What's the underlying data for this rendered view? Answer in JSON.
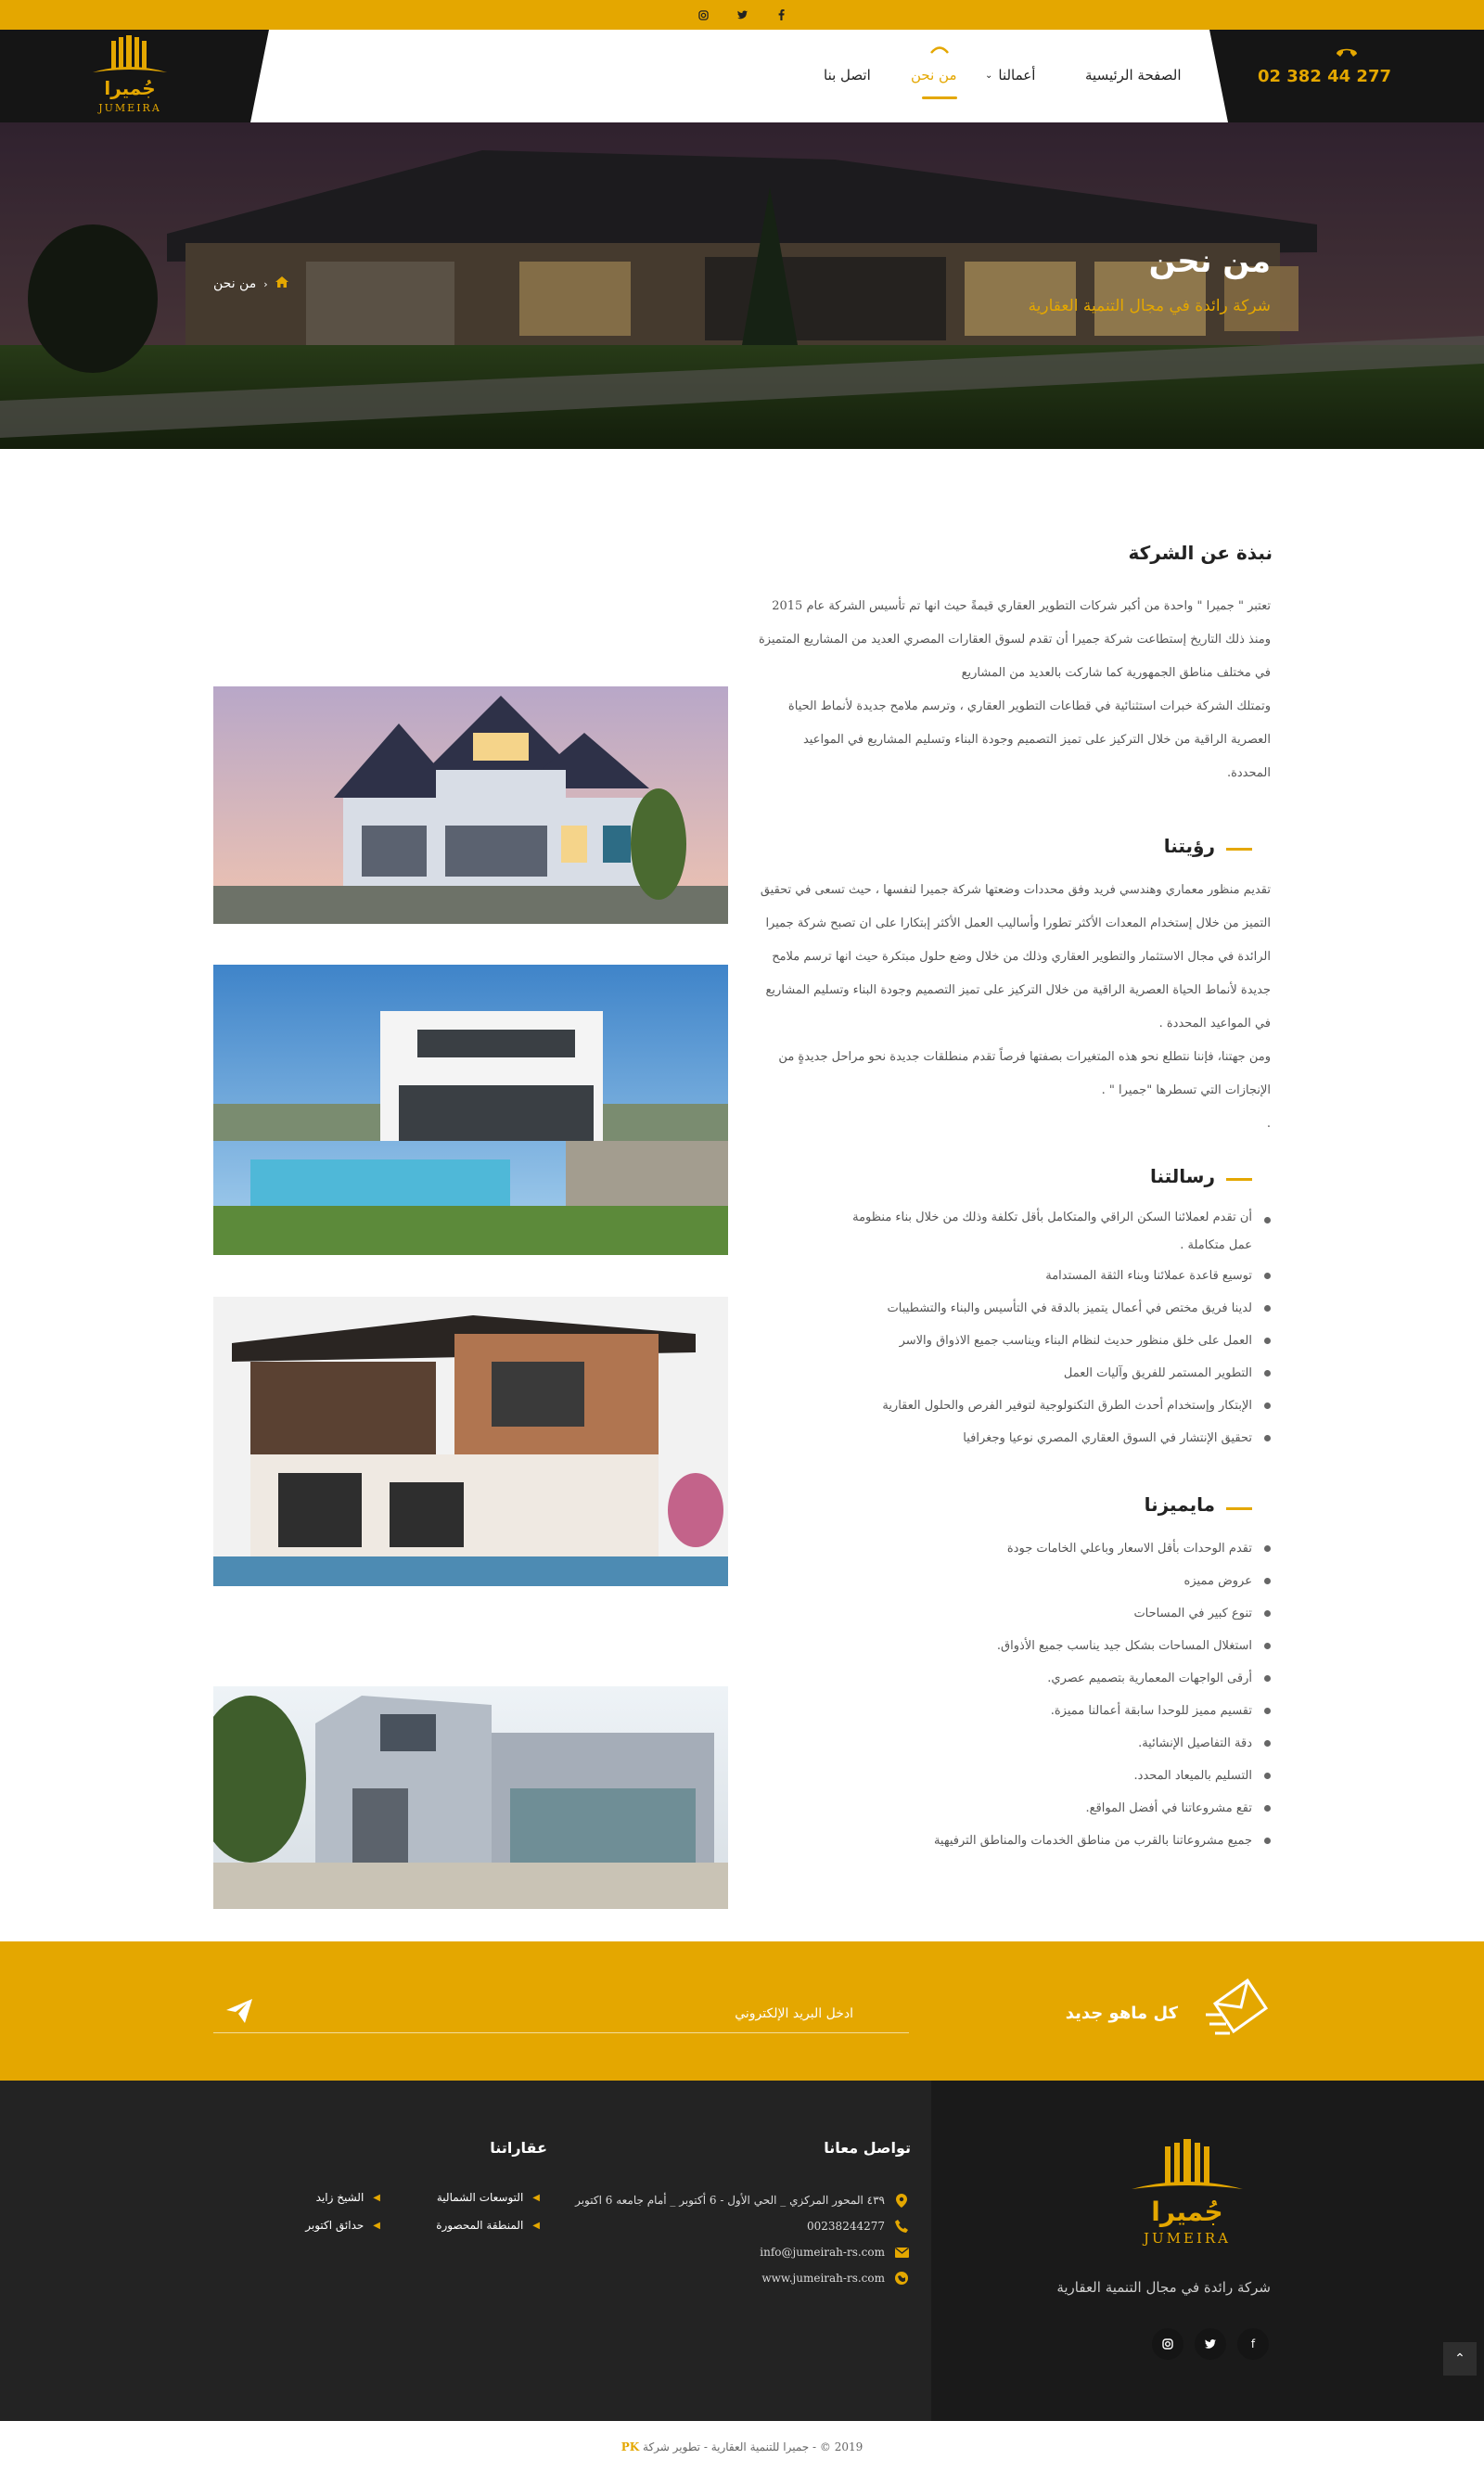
{
  "topbar": {
    "icons": [
      "instagram-icon",
      "twitter-icon",
      "facebook-icon"
    ]
  },
  "header": {
    "phone": "02 382 44 277",
    "logo_ar": "جُميرا",
    "logo_en": "JUMEIRA",
    "nav": [
      {
        "label": "الصفحة الرئيسية",
        "active": false
      },
      {
        "label": "أعمالنا",
        "active": false,
        "has_dropdown": true
      },
      {
        "label": "من نحن",
        "active": true
      },
      {
        "label": "اتصل بنا",
        "active": false
      }
    ]
  },
  "hero": {
    "title": "من نحن",
    "subtitle": "شركة رائدة في مجال التنمية العقارية",
    "breadcrumb": "من نحن"
  },
  "about": {
    "title": "نبذة عن الشركة",
    "lines": [
      "تعتبر \" جميرا \" واحدة من أكبر شركات التطوير العقاري قيمةً حيث انها تم تأسيس الشركة عام 2015",
      "ومنذ ذلك التاريخ إستطاعت شركة جميرا أن تقدم لسوق العقارات المصري العديد من المشاريع المتميزة",
      "في مختلف مناطق الجمهورية كما شاركت بالعديد من المشاريع",
      "وتمتلك الشركة خبرات استثنائية في قطاعات التطوير العقاري ، وترسم ملامح جديدة لأنماط الحياة",
      "العصرية الراقية من خلال التركيز على تميز التصميم وجودة البناء وتسليم المشاريع في المواعيد",
      "المحددة."
    ]
  },
  "vision": {
    "title": "رؤيتنا",
    "lines": [
      "تقديم منظور معماري وهندسي فريد وفق محددات وضعتها شركة جميرا لنفسها ، حيث تسعى في تحقيق",
      "التميز من خلال إستخدام المعدات الأكثر تطورا وأساليب العمل الأكثر إبتكارا على ان تصبح شركة جميرا",
      "الرائدة في مجال الاستثمار والتطوير العقاري وذلك من خلال وضع حلول مبتكرة حيث انها ترسم ملامح",
      "جديدة لأنماط الحياة العصرية الراقية من خلال التركيز على تميز التصميم وجودة البناء وتسليم المشاريع",
      "في المواعيد المحددة .",
      "ومن جهتنا، فإننا نتطلع نحو هذه المتغيرات بصفتها فرصاً تقدم منطلقات جديدة نحو مراحل جديدةٍ من",
      "الإنجازات التي تسطرها \"جميرا \" .",
      "."
    ]
  },
  "mission": {
    "title": "رسالتنا",
    "items": [
      "أن تقدم لعملائنا السكن الراقي والمتكامل بأقل تكلفة وذلك من خلال بناء منظومة عمل متكاملة .",
      "توسيع قاعدة عملائنا وبناء الثقة المستدامة",
      "لدينا فريق مختص في أعمال يتميز بالدقة في التأسيس والبناء والتشطيبات",
      "العمل على خلق منظور حديث لنظام البناء ويناسب جميع الاذواق والاسر",
      "التطوير المستمر للفريق وآليات العمل",
      "الإبتكار وإستخدام أحدث الطرق التكنولوجية لتوفير الفرص والحلول العقارية",
      "تحقيق الإنتشار في السوق العقاري المصري نوعيا وجغرافيا"
    ]
  },
  "features": {
    "title": "مايميزنا",
    "items": [
      "تقدم الوحدات بأقل الاسعار وباعلي الخامات جودة",
      "عروض مميزه",
      "تنوع كبير في المساحات",
      "استغلال المساحات بشكل جيد يناسب جميع الأذواق.",
      "أرقى الواجهات المعمارية بتصميم عصري.",
      "تقسيم مميز للوحدا سابقة أعمالنا مميزة.",
      "دقة التفاصيل الإنشائية.",
      "التسليم بالميعاد المحدد.",
      "تقع مشروعاتنا في أفضل المواقع.",
      "جميع مشروعاتنا بالقرب من مناطق الخدمات والمناطق الترفيهية"
    ]
  },
  "newsletter": {
    "title": "كل ماهو جديد",
    "placeholder": "ادخل البريد الإلكتروني"
  },
  "footer": {
    "tagline": "شركة رائدة في مجال التنمية العقارية",
    "contact_title": "تواصل معانا",
    "contact": [
      {
        "icon": "location-icon",
        "text": "٤٣٩ المحور المركزي _ الحي الأول - 6 أكتوبر _ أمام جامعه 6 اكتوبر"
      },
      {
        "icon": "phone-icon",
        "text": "00238244277"
      },
      {
        "icon": "mail-icon",
        "text": "info@jumeirah-rs.com"
      },
      {
        "icon": "globe-icon",
        "text": "www.jumeirah-rs.com"
      }
    ],
    "properties_title": "عقاراتنا",
    "properties": [
      [
        "التوسعات الشمالية",
        "الشيخ زايد"
      ],
      [
        "المنطقة المحصورة",
        "حدائق اكتوبر"
      ]
    ],
    "social": [
      "facebook-icon",
      "twitter-icon",
      "instagram-icon"
    ]
  },
  "copyright": {
    "text": "2019 © - جميرا للتنمية العقارية - تطوير شركة",
    "brand": "PK"
  },
  "colors": {
    "accent": "#e4a700",
    "dark": "#151515",
    "footer": "#232323"
  }
}
